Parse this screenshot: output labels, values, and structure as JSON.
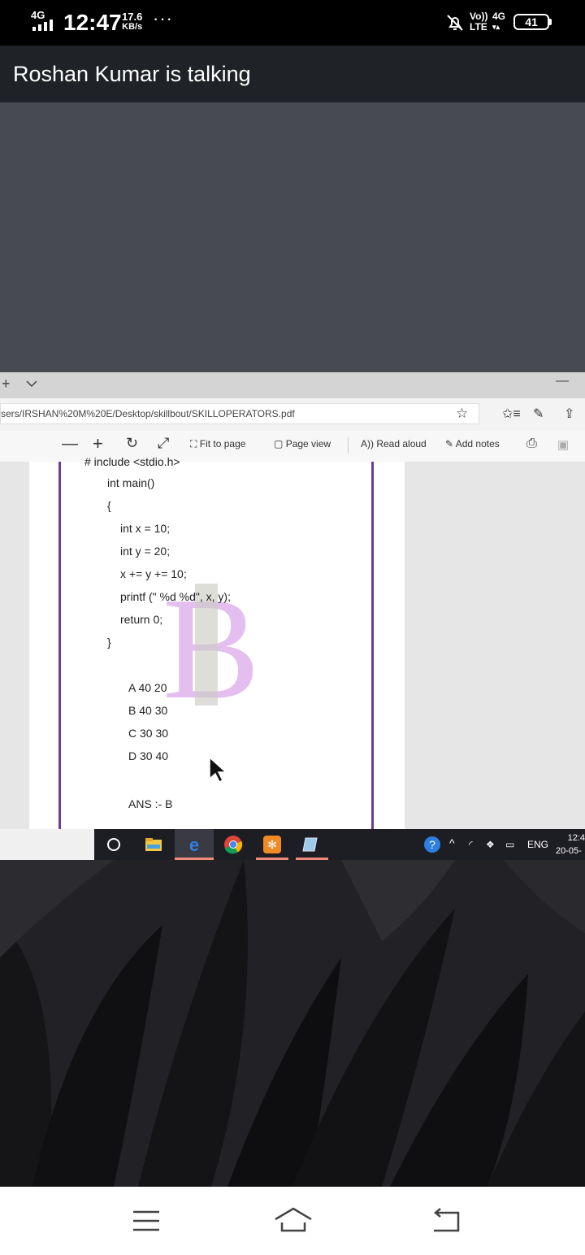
{
  "status_bar": {
    "network": "4G",
    "time": "12:47",
    "speed_value": "17.6",
    "speed_unit": "KB/s",
    "overflow": "···",
    "volte_top": "Vo))",
    "volte_bottom": "LTE",
    "net_type": "4G",
    "battery": "41"
  },
  "call": {
    "title": "Roshan Kumar is talking"
  },
  "browser": {
    "url": "sers/IRSHAN%20M%20E/Desktop/skillbout/SKILLOPERATORS.pdf",
    "toolbar": {
      "fit_to_page": "Fit to page",
      "page_view": "Page view",
      "read_aloud": "Read aloud",
      "add_notes": "Add notes"
    }
  },
  "pdf": {
    "cut_line": "# include <stdio.h>",
    "code_lines": [
      "int main()",
      "{",
      "   int x = 10;",
      "   int y = 20;",
      "   x += y += 10;",
      "   printf (\" %d %d\", x, y);",
      "   return 0;",
      "}"
    ],
    "options": [
      "A 40 20",
      "B 40 30",
      "C 30 30",
      "D 30 40"
    ],
    "answer": "ANS :- B"
  },
  "taskbar": {
    "language": "ENG",
    "clock_time": "12:4",
    "clock_date": "20-05-"
  },
  "icons": {
    "status": [
      "signal-icon",
      "mute-bell-icon",
      "battery-icon"
    ],
    "browser": [
      "plus-icon",
      "chevron-down-icon",
      "star-icon",
      "favorites-icon",
      "pen-icon",
      "share-icon",
      "zoom-out-icon",
      "zoom-in-icon",
      "rotate-icon",
      "fullscreen-icon",
      "print-icon",
      "save-icon"
    ],
    "taskbar": [
      "cortana-icon",
      "file-explorer-icon",
      "edge-icon",
      "chrome-icon",
      "app-icon",
      "notepad-icon",
      "help-icon",
      "wifi-icon",
      "dropbox-icon",
      "battery-tray-icon"
    ],
    "nav": [
      "menu-icon",
      "home-icon",
      "back-icon"
    ]
  },
  "colors": {
    "accent_purple": "#6a3d9a",
    "watermark_pink": "#e0b8ee",
    "taskbar": "#1d1d24"
  }
}
